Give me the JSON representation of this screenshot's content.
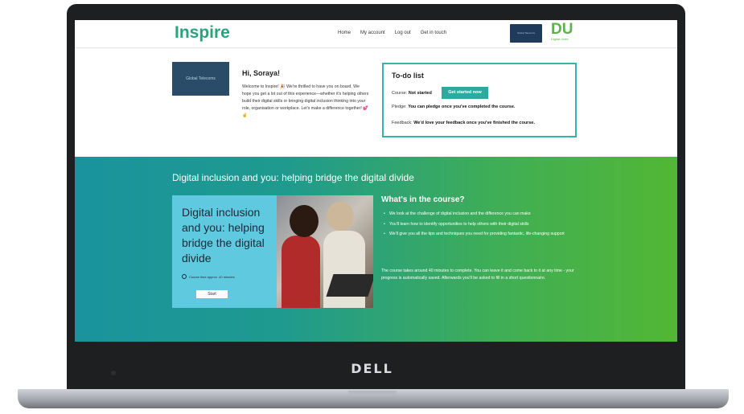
{
  "device": {
    "brand": "DELL"
  },
  "header": {
    "logo": "Inspire",
    "nav": [
      "Home",
      "My account",
      "Log out",
      "Get in touch"
    ],
    "partner_label": "Global Telecoms",
    "du_mark": "DU",
    "du_sub": "Digital Unite"
  },
  "welcome": {
    "image_label": "Global Telecoms",
    "greeting": "Hi, Soraya!",
    "text": "Welcome to Inspire! 🎉 We're thrilled to have you on board. We hope you get a lot out of this experience—whether it's helping others build their digital skills or bringing digital inclusion thinking into your role, organisation or workplace. Let's make a difference together! 💕 ✌"
  },
  "todo": {
    "title": "To-do list",
    "course_label": "Course:",
    "course_status": "Not started",
    "course_button": "Get started now",
    "pledge_label": "Pledge:",
    "pledge_text": "You can pledge once you've completed the course.",
    "feedback_label": "Feedback:",
    "feedback_text": "We'd love your feedback once you've finished the course."
  },
  "course": {
    "section_title": "Digital inclusion and you: helping bridge the digital divide",
    "card_title": "Digital inclusion and you: helping bridge the digital divide",
    "card_time": "Course time approx. 40 minutes",
    "card_button": "Start",
    "heading": "What's in the course?",
    "bullets": [
      "We look at the challenge of digital inclusion and the difference you can make",
      "You'll learn how to identify opportunities to help others with their digital skills",
      "We'll give you all the tips and techniques you need for providing fantastic, life-changing support"
    ],
    "paragraph": "The course takes around 40 minutes to complete. You can leave it and come back to it at any time - your progress is automatically saved. Afterwards you'll be asked to fill in a short questionnaire."
  },
  "colors": {
    "accent": "#2fa9a0",
    "brand_green": "#2aa37a",
    "du_green": "#5bb24a"
  }
}
